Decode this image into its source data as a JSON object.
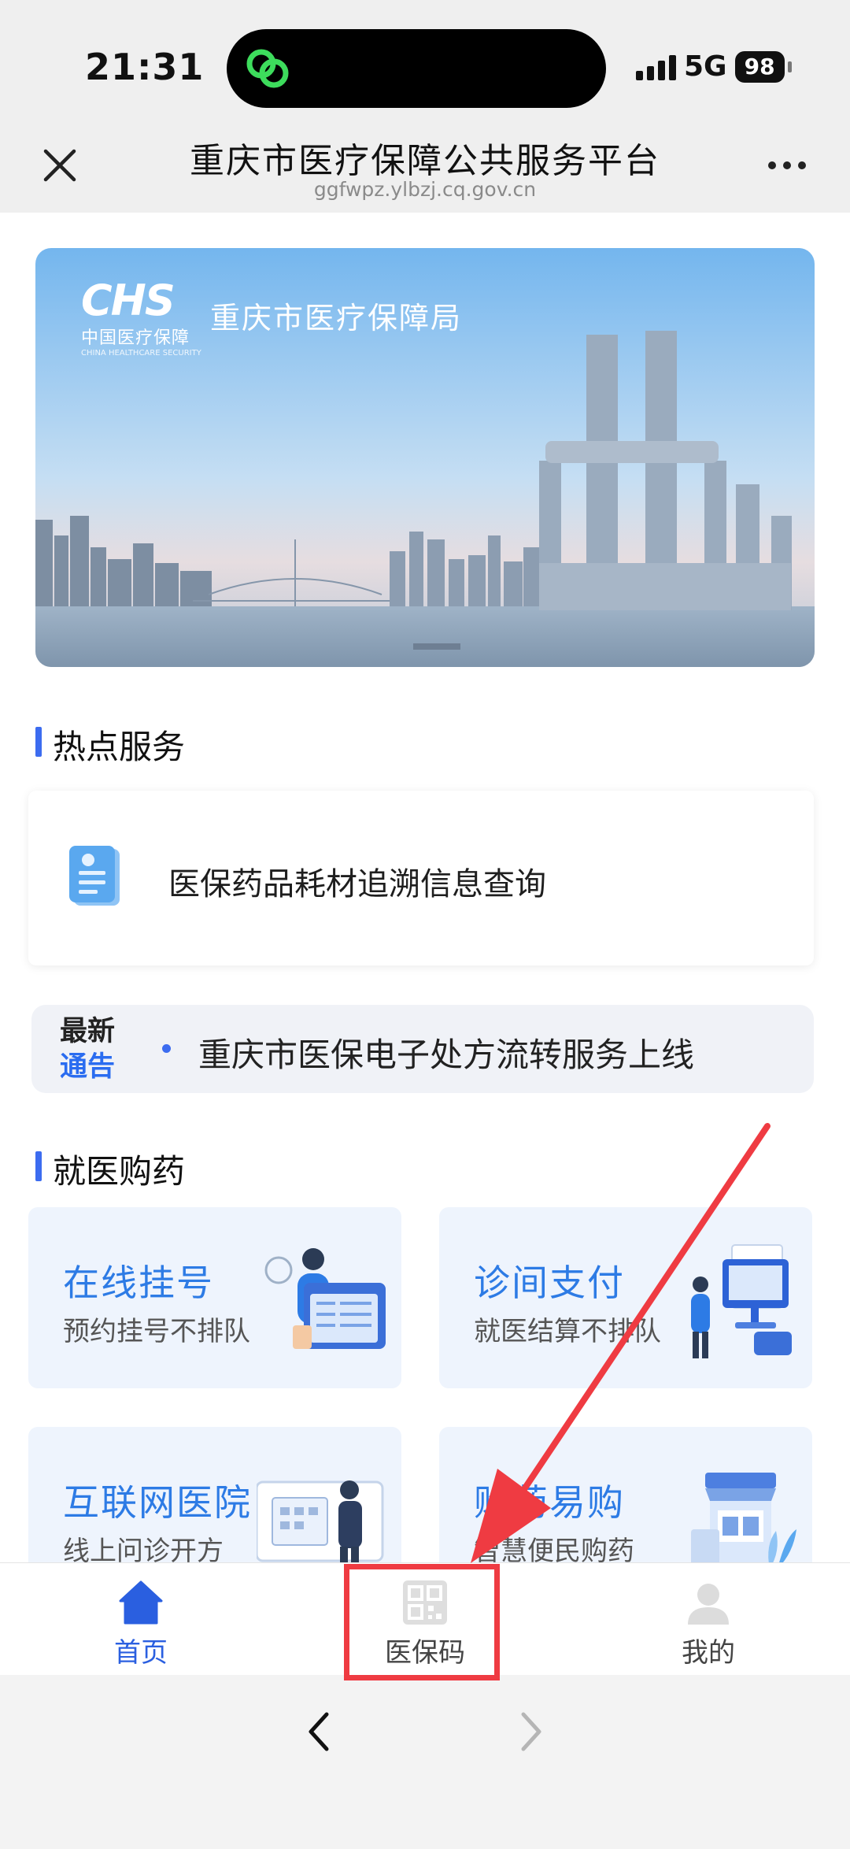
{
  "status_bar": {
    "time": "21:31",
    "network": "5G",
    "battery": "98"
  },
  "header": {
    "title": "重庆市医疗保障公共服务平台",
    "url": "ggfwpz.ylbzj.cq.gov.cn"
  },
  "banner": {
    "logo_mark": "CHS",
    "logo_cn": "中国医疗保障",
    "logo_en": "CHINA HEALTHCARE SECURITY",
    "org_name": "重庆市医疗保障局"
  },
  "hot_services": {
    "section_title": "热点服务",
    "items": [
      {
        "label": "医保药品耗材追溯信息查询",
        "icon": "document-icon"
      }
    ]
  },
  "notice": {
    "badge_line1": "最新",
    "badge_line2": "通告",
    "text": "重庆市医保电子处方流转服务上线"
  },
  "medical": {
    "section_title": "就医购药",
    "tiles": [
      {
        "title": "在线挂号",
        "subtitle": "预约挂号不排队"
      },
      {
        "title": "诊间支付",
        "subtitle": "就医结算不排队"
      },
      {
        "title": "互联网医院",
        "subtitle": "线上问诊开方"
      },
      {
        "title": "购药易购",
        "subtitle": "智慧便民购药"
      }
    ]
  },
  "bottom_nav": {
    "items": [
      {
        "label": "首页",
        "icon": "home-icon",
        "active": true
      },
      {
        "label": "医保码",
        "icon": "qr-code-icon",
        "active": false
      },
      {
        "label": "我的",
        "icon": "user-icon",
        "active": false
      }
    ]
  },
  "colors": {
    "accent": "#2a5fe0",
    "tile_title": "#2d7be5",
    "annotation": "#ef3b42"
  }
}
